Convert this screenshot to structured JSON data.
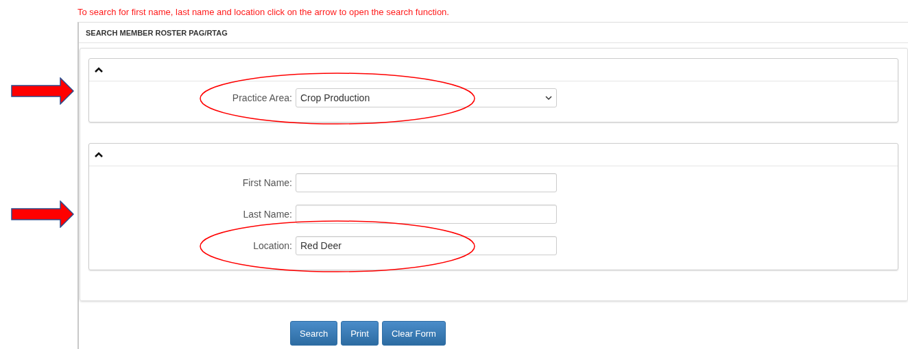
{
  "note": "To search for first name, last name and location click on the arrow to open the search function.",
  "panel": {
    "title": "SEARCH MEMBER ROSTER PAG/RTAG"
  },
  "sections": [
    {
      "expanded": true,
      "fields": [
        {
          "label": "Practice Area:",
          "kind": "select",
          "value": "Crop Production",
          "annotated": true
        }
      ]
    },
    {
      "expanded": true,
      "fields": [
        {
          "label": "First Name:",
          "kind": "text",
          "annotated": false
        },
        {
          "label": "Last Name:",
          "kind": "text",
          "annotated": false
        },
        {
          "label": "Location:",
          "kind": "text",
          "value": "Red Deer",
          "annotated": true
        }
      ]
    }
  ],
  "buttons": [
    "Search",
    "Print",
    "Clear Form"
  ]
}
